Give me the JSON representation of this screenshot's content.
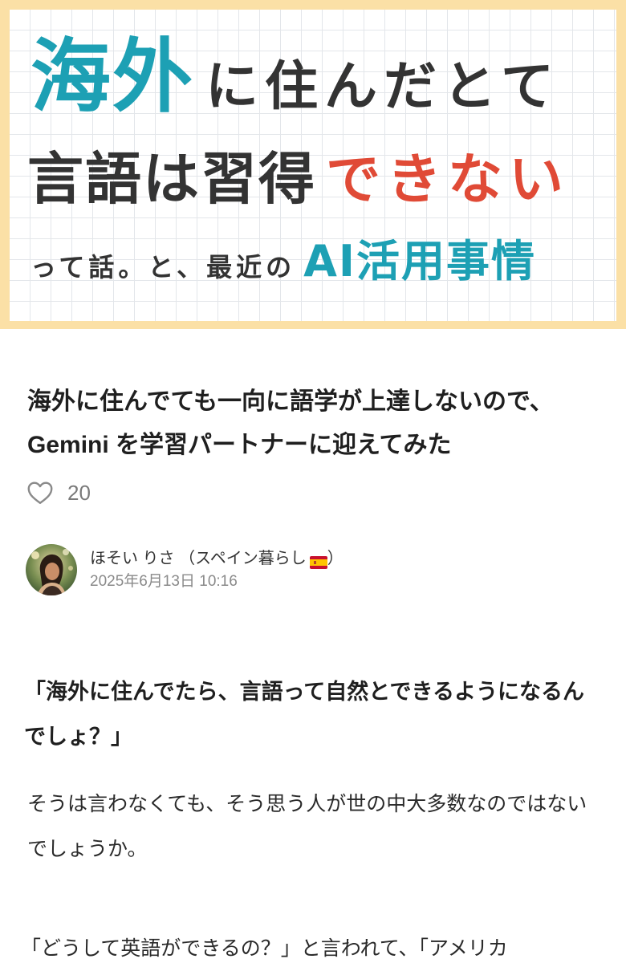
{
  "hero": {
    "line1_teal": "海外",
    "line1_dark": "に住んだとて",
    "line2_dark": "言語は習得",
    "line2_red": "できない",
    "line3_dark": "って話。と、最近の",
    "line3_teal": "AI活用事情"
  },
  "article": {
    "title": "海外に住んでても一向に語学が上達しないので、Gemini を学習パートナーに迎えてみた",
    "like_count": "20",
    "author_name": "ほそい りさ （スペイン暮らし",
    "author_name_close": "）",
    "author_flag_icon": "spain-flag-icon",
    "date": "2025年6月13日 10:16"
  },
  "body": {
    "lead_quote": "「海外に住んでたら、言語って自然とできるようになるんでしょ？」",
    "paragraph1": "そうは言わなくても、そう思う人が世の中大多数なのではないでしょうか。",
    "paragraph2": "「どうして英語ができるの？」と言われて、「アメリカ"
  },
  "colors": {
    "teal": "#1da0b4",
    "red": "#e04a36",
    "frame": "#fbe0a6"
  }
}
